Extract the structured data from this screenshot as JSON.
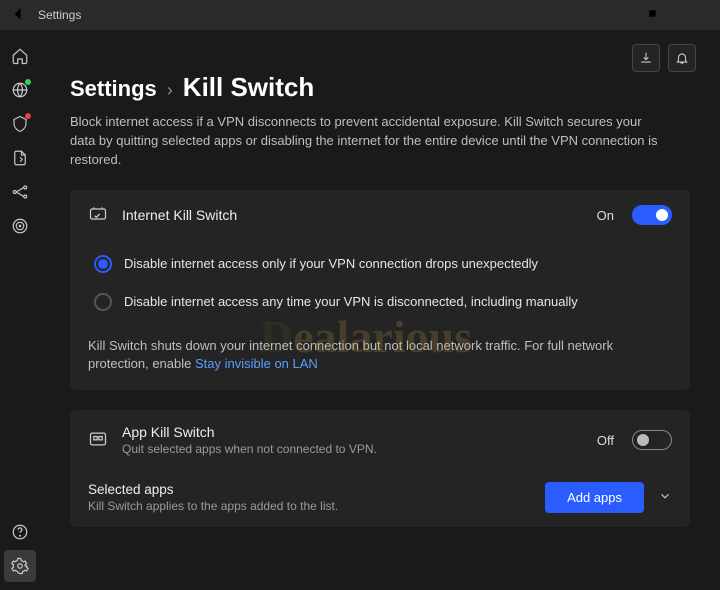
{
  "titlebar": {
    "title": "Settings"
  },
  "breadcrumb": {
    "root": "Settings",
    "leaf": "Kill Switch"
  },
  "description": "Block internet access if a VPN disconnects to prevent accidental exposure. Kill Switch secures your data by quitting selected apps or disabling the internet for the entire device until the VPN connection is restored.",
  "internetKill": {
    "title": "Internet Kill Switch",
    "state": "On",
    "options": [
      "Disable internet access only if your VPN connection drops unexpectedly",
      "Disable internet access any time your VPN is disconnected, including manually"
    ],
    "note_prefix": "Kill Switch shuts down your internet connection but not local network traffic. For full network protection, enable ",
    "note_link": "Stay invisible on LAN"
  },
  "appKill": {
    "title": "App Kill Switch",
    "subtitle": "Quit selected apps when not connected to VPN.",
    "state": "Off"
  },
  "selectedApps": {
    "title": "Selected apps",
    "subtitle": "Kill Switch applies to the apps added to the list.",
    "button": "Add apps"
  },
  "watermark": "Dealarious"
}
